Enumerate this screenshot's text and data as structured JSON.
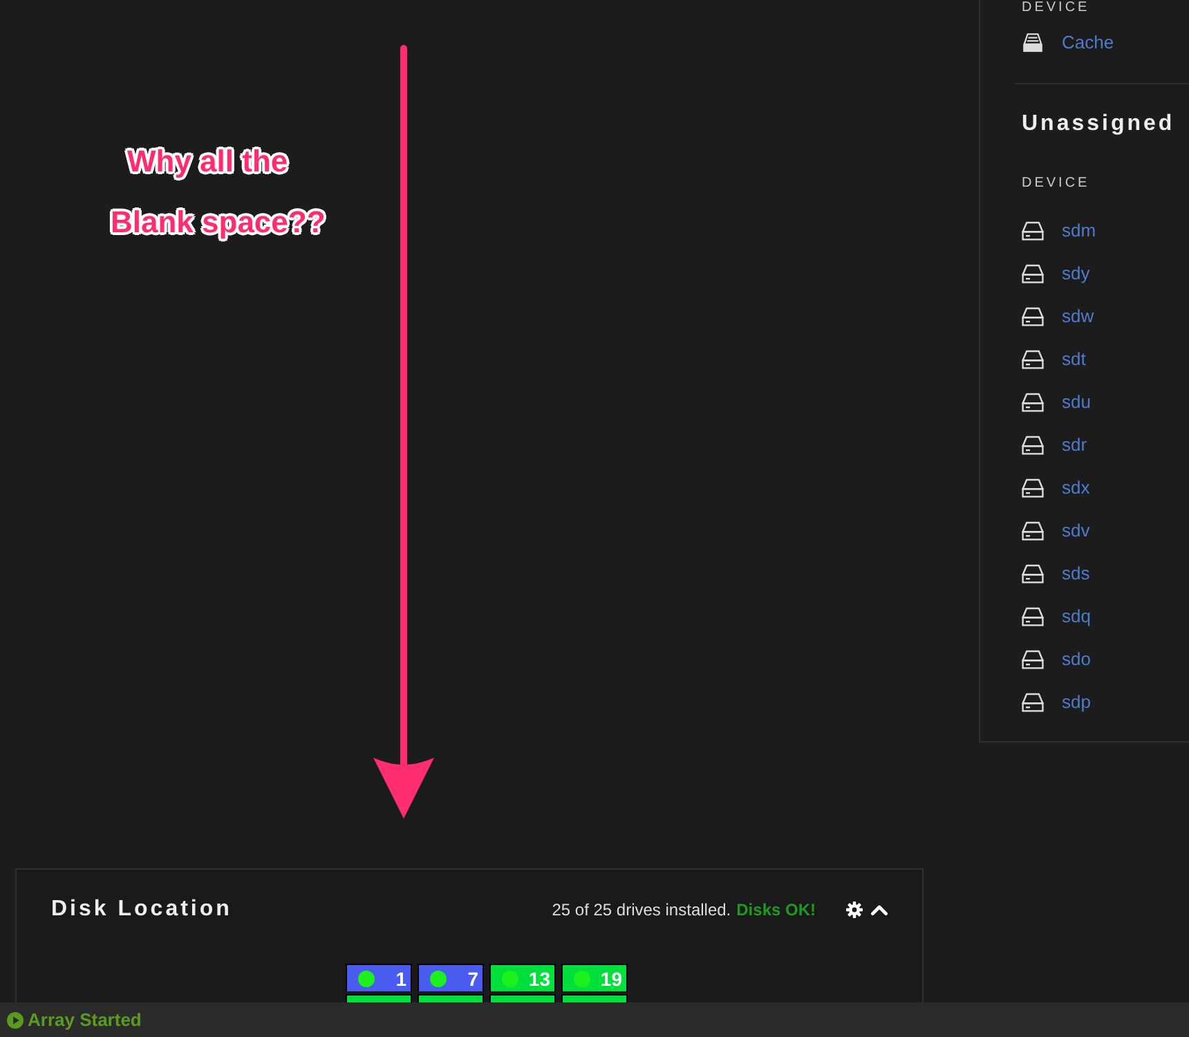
{
  "annotation": {
    "lines": [
      "Why all the",
      "Blank space??"
    ]
  },
  "side_panel": {
    "sections": [
      {
        "column_header": "DEVICE",
        "devices": [
          {
            "kind": "cache",
            "name": "Cache"
          }
        ]
      },
      {
        "title": "Unassigned",
        "column_header": "DEVICE",
        "devices": [
          {
            "kind": "disk",
            "name": "sdm"
          },
          {
            "kind": "disk",
            "name": "sdy"
          },
          {
            "kind": "disk",
            "name": "sdw"
          },
          {
            "kind": "disk",
            "name": "sdt"
          },
          {
            "kind": "disk",
            "name": "sdu"
          },
          {
            "kind": "disk",
            "name": "sdr"
          },
          {
            "kind": "disk",
            "name": "sdx"
          },
          {
            "kind": "disk",
            "name": "sdv"
          },
          {
            "kind": "disk",
            "name": "sds"
          },
          {
            "kind": "disk",
            "name": "sdq"
          },
          {
            "kind": "disk",
            "name": "sdo"
          },
          {
            "kind": "disk",
            "name": "sdp"
          }
        ]
      }
    ]
  },
  "disk_location": {
    "title": "Disk Location",
    "summary": "25 of 25 drives installed.",
    "status": "Disks OK!",
    "trays": [
      {
        "label": "1",
        "color": "#4a5cf0",
        "led": true
      },
      {
        "label": "7",
        "color": "#4a5cf0",
        "led": true
      },
      {
        "label": "13",
        "color": "#00e03c",
        "led": true
      },
      {
        "label": "19",
        "color": "#00e03c",
        "led": true
      },
      {
        "color": "#00e03c"
      },
      {
        "color": "#00e03c"
      },
      {
        "color": "#00e03c"
      },
      {
        "color": "#00e03c"
      }
    ]
  },
  "status_bar": {
    "text": "Array Started"
  }
}
